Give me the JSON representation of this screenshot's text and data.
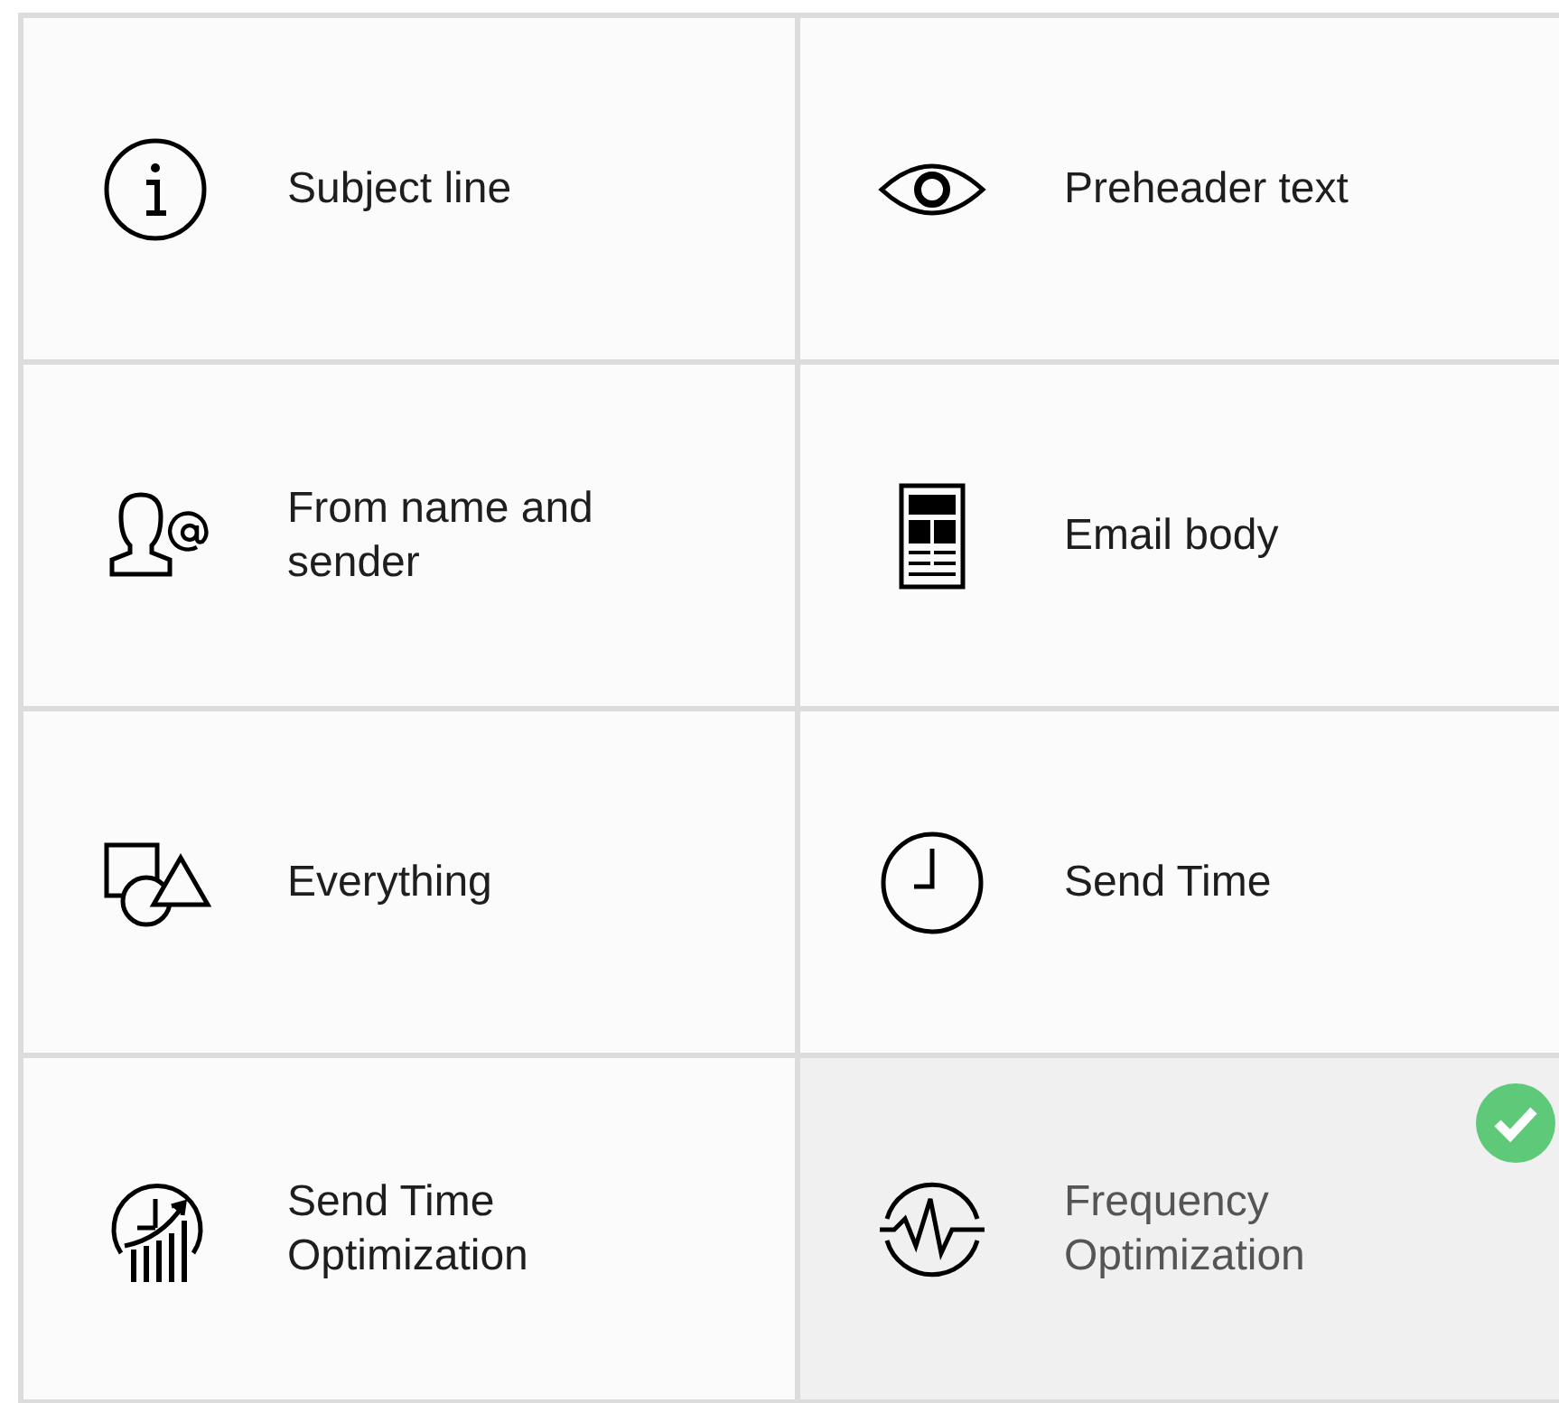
{
  "options": [
    {
      "kind": "info",
      "label": "Subject line",
      "selected": false
    },
    {
      "kind": "eye",
      "label": "Preheader text",
      "selected": false
    },
    {
      "kind": "sender",
      "label": "From name and sender",
      "selected": false
    },
    {
      "kind": "body",
      "label": "Email body",
      "selected": false
    },
    {
      "kind": "shapes",
      "label": "Everything",
      "selected": false
    },
    {
      "kind": "clock",
      "label": "Send Time",
      "selected": false
    },
    {
      "kind": "growth",
      "label": "Send Time Optimization",
      "selected": false
    },
    {
      "kind": "pulse",
      "label": "Frequency Optimization",
      "selected": true
    }
  ]
}
